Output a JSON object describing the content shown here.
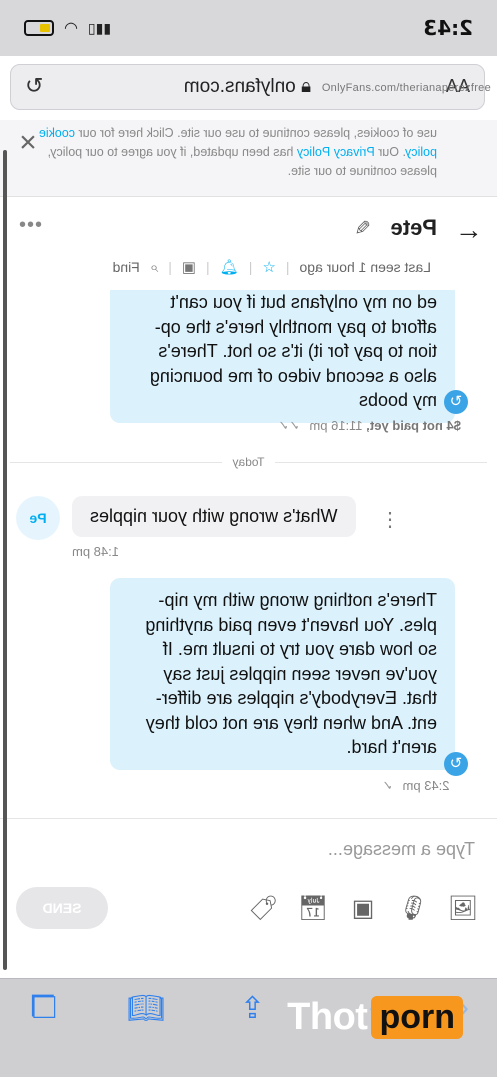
{
  "status_bar": {
    "time": "2:43"
  },
  "browser": {
    "aa_label": "AA",
    "url": "onlyfans.com",
    "lock_icon": "lock-icon",
    "reload_icon": "reload-icon"
  },
  "cookie_banner": {
    "text_before_link1": "use of cookies, please continue to use our site. Click here for our ",
    "link1": "cookie policy",
    "text_mid": ". Our ",
    "link2": "Privacy Policy",
    "text_after": " has been updated, if you agree to our policy, please continue to our site."
  },
  "chat_header": {
    "name": "Pete",
    "last_seen": "Last seen 1 hour ago",
    "find_label": "Find"
  },
  "messages": {
    "m1_text": "ed on my onlyfans but if you can't afford to pay monthly here's the option to pay for it) it's so hot. There's also a second video of me bouncing my boobs",
    "m1_lines": [
      "ed on my onlyfans but if you can't",
      "afford to pay monthly here's the op-",
      "tion to pay for it) it's so hot. There's",
      "also a second video of me bouncing",
      "my boobs"
    ],
    "m1_price": "$4 not paid yet,",
    "m1_time": "11:16 pm",
    "day_divider": "Today",
    "m2_text": "What's wrong with your nipples",
    "m2_avatar": "Pe",
    "m2_time": "1:48 pm",
    "m3_lines": [
      "There's nothing wrong with my nip-",
      "ples. You haven't even paid anything",
      "so how dare you try to insult me. If",
      "you've never seen nipples just say",
      "that. Everybody's nipples are differ-",
      "ent. And when they are not cold they",
      "aren't hard."
    ],
    "m3_time": "2:43 pm"
  },
  "composer": {
    "placeholder": "Type a message...",
    "send_label": "SEND",
    "tools": [
      "image-icon",
      "microphone-icon",
      "media-vault-icon",
      "calendar-icon",
      "price-tag-icon"
    ]
  },
  "watermark": {
    "url": "OnlyFans.com/therianaperezfree",
    "logo_left": "Thot",
    "logo_right": "porn"
  },
  "colors": {
    "accent": "#00aff0",
    "bubble_out": "#dbf1fc",
    "bubble_in": "#f1f1f3",
    "logo_orange": "#f7971e"
  }
}
